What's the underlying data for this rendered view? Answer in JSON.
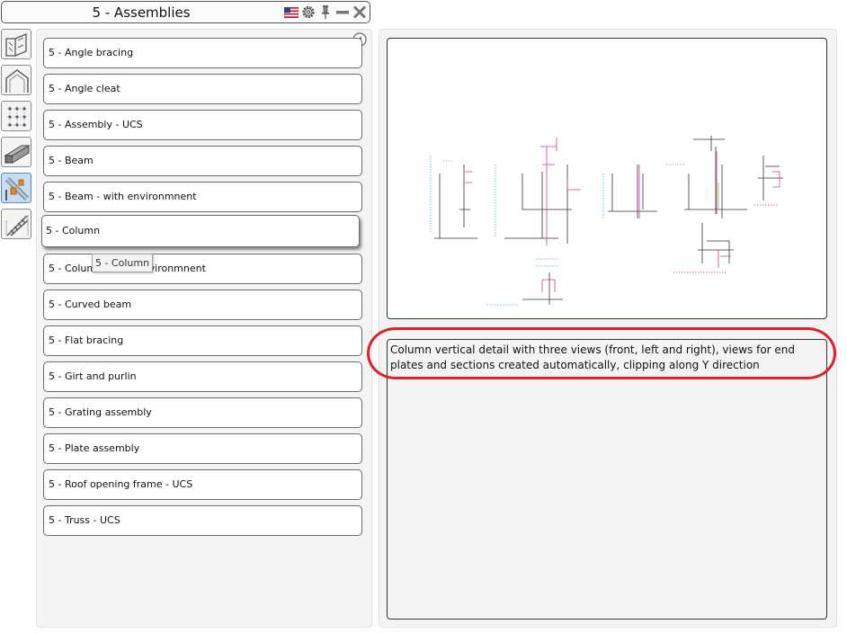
{
  "window": {
    "title": "5 - Assemblies",
    "toolbar_icons": [
      "flag-us-icon",
      "settings-icon",
      "pin-icon",
      "minimize-icon",
      "close-icon"
    ]
  },
  "categories": [
    {
      "name": "connections-category-icon",
      "active": false
    },
    {
      "name": "building-frame-category-icon",
      "active": false
    },
    {
      "name": "grid-category-icon",
      "active": false
    },
    {
      "name": "beam-category-icon",
      "active": false
    },
    {
      "name": "assemblies-category-icon",
      "active": true
    },
    {
      "name": "stairs-category-icon",
      "active": false
    }
  ],
  "items": [
    {
      "label": "5 - Angle bracing"
    },
    {
      "label": "5 - Angle cleat"
    },
    {
      "label": "5 - Assembly - UCS"
    },
    {
      "label": "5 - Beam"
    },
    {
      "label": "5 - Beam - with environmnent"
    },
    {
      "label": "5 - Column"
    },
    {
      "label": "5 - Column - with environmnent"
    },
    {
      "label": "5 - Curved beam"
    },
    {
      "label": "5 - Flat bracing"
    },
    {
      "label": "5 - Girt and purlin"
    },
    {
      "label": "5 - Grating assembly"
    },
    {
      "label": "5 - Plate assembly"
    },
    {
      "label": "5 - Roof opening frame - UCS"
    },
    {
      "label": "5 - Truss - UCS"
    }
  ],
  "hovered_index": 5,
  "tooltip": "5 - Column",
  "description": "Column vertical detail with three views (front, left and right), views for end plates and sections created automatically, clipping along Y direction",
  "colors": {
    "highlight": "#e01f26",
    "active_category": "#c8ddf2"
  }
}
